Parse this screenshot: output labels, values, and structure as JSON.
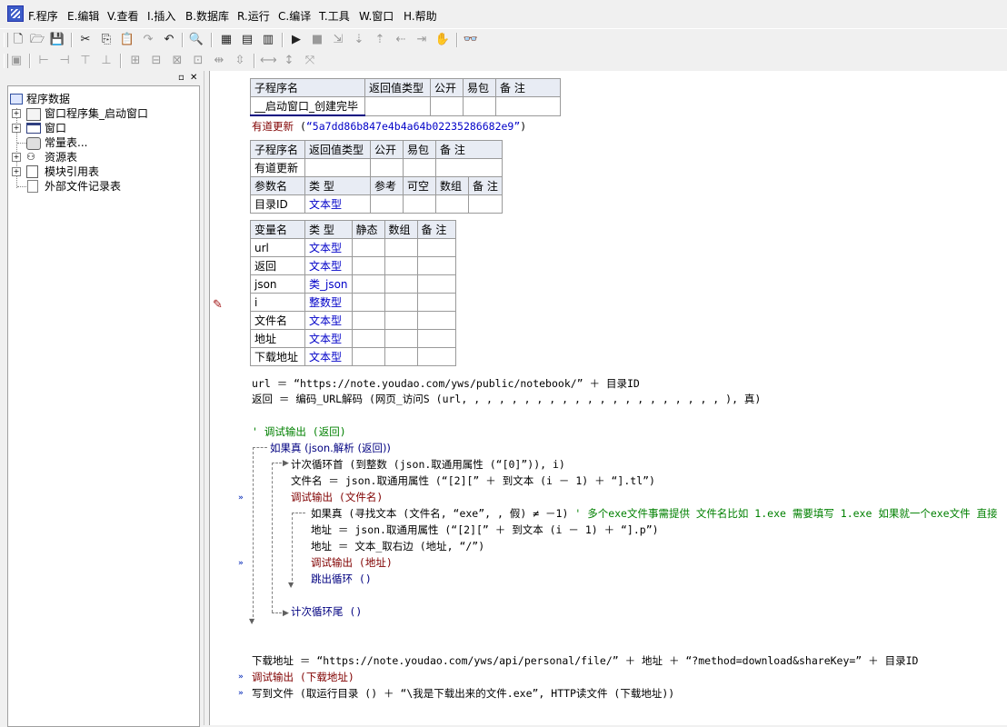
{
  "menu": [
    "F.程序",
    "E.编辑",
    "V.查看",
    "I.插入",
    "B.数据库",
    "R.运行",
    "C.编译",
    "T.工具",
    "W.窗口",
    "H.帮助"
  ],
  "tree": {
    "root": "程序数据",
    "items": [
      "窗口程序集_启动窗口",
      "窗口",
      "常量表...",
      "资源表",
      "模块引用表",
      "外部文件记录表"
    ]
  },
  "sub1": {
    "headers": [
      "子程序名",
      "返回值类型",
      "公开",
      "易包",
      "备 注"
    ],
    "name": "__启动窗口_创建完毕"
  },
  "call_line": {
    "func": "有道更新",
    "arg": "“5a7dd86b847e4b4a64b02235286682e9”"
  },
  "sub2": {
    "headers": [
      "子程序名",
      "返回值类型",
      "公开",
      "易包",
      "备 注"
    ],
    "name": "有道更新",
    "param_headers": [
      "参数名",
      "类 型",
      "参考",
      "可空",
      "数组",
      "备 注"
    ],
    "param_name": "目录ID",
    "param_type": "文本型"
  },
  "vars": {
    "headers": [
      "变量名",
      "类 型",
      "静态",
      "数组",
      "备 注"
    ],
    "rows": [
      {
        "name": "url",
        "type": "文本型"
      },
      {
        "name": "返回",
        "type": "文本型"
      },
      {
        "name": "json",
        "type": "类_json"
      },
      {
        "name": "i",
        "type": "整数型"
      },
      {
        "name": "文件名",
        "type": "文本型"
      },
      {
        "name": "地址",
        "type": "文本型"
      },
      {
        "name": "下载地址",
        "type": "文本型"
      }
    ]
  },
  "code": {
    "l1": "url ＝ “https://note.youdao.com/yws/public/notebook/” ＋ 目录ID",
    "l2": "返回 ＝ 编码_URL解码 (网页_访问S (url, , , , , , , , , , , , , , , , , , , , , ), 真)",
    "l3": "' 调试输出 (返回)",
    "l4": "如果真 (json.解析 (返回))",
    "l5": "计次循环首 (到整数 (json.取通用属性 (“[0]”)), i)",
    "l6": "文件名 ＝ json.取通用属性 (“[2][” ＋ 到文本 (i － 1) ＋ “].tl”)",
    "l7": "调试输出 (文件名)",
    "l8": "如果真 (寻找文本 (文件名, “exe”, , 假) ≠ －1)",
    "l8c": "' 多个exe文件事需提供 文件名比如 1.exe  需要填写 1.exe   如果就一个exe文件 直接",
    "l9": "地址 ＝ json.取通用属性 (“[2][” ＋ 到文本 (i － 1) ＋ “].p”)",
    "l10": "地址 ＝ 文本_取右边 (地址, “/”)",
    "l11": "调试输出 (地址)",
    "l12": "跳出循环 ()",
    "l13": "计次循环尾 ()",
    "l14": "下载地址 ＝ “https://note.youdao.com/yws/api/personal/file/” ＋ 地址 ＋ “?method=download&shareKey=” ＋ 目录ID",
    "l15": "调试输出 (下载地址)",
    "l16": "写到文件 (取运行目录 () ＋ “\\我是下载出来的文件.exe”, HTTP读文件 (下载地址))"
  }
}
